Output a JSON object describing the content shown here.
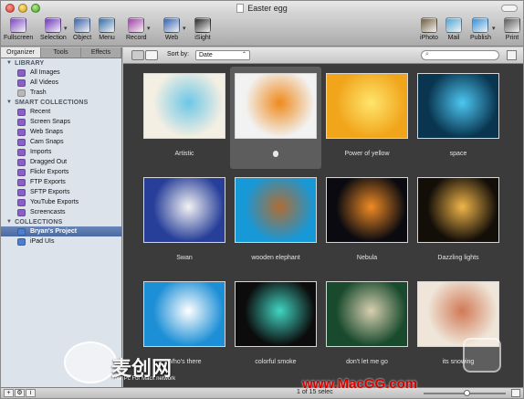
{
  "window": {
    "title": "Easter egg"
  },
  "toolbar": {
    "left": [
      {
        "label": "Fullscreen",
        "color": "#7a42c4"
      },
      {
        "label": "Selection",
        "color": "#6b2fbd"
      },
      {
        "label": "Object",
        "color": "#355ea8"
      },
      {
        "label": "Menu",
        "color": "#2c6aa8"
      },
      {
        "label": "Record",
        "color": "#a13aa7"
      },
      {
        "label": "Web",
        "color": "#2f5fb0"
      },
      {
        "label": "iSight",
        "color": "#222222"
      }
    ],
    "right": [
      {
        "label": "iPhoto",
        "color": "#6e5b3a"
      },
      {
        "label": "Mail",
        "color": "#4aa4d8"
      },
      {
        "label": "Publish",
        "color": "#2e8ed9"
      },
      {
        "label": "Print",
        "color": "#555555"
      }
    ]
  },
  "sidebar": {
    "tabs": [
      "Organizer",
      "Tools",
      "Effects"
    ],
    "sections": [
      {
        "title": "LIBRARY",
        "items": [
          {
            "label": "All Images",
            "color": "#8a60c8"
          },
          {
            "label": "All Videos",
            "color": "#8a60c8"
          },
          {
            "label": "Trash",
            "color": "#b8b8b8"
          }
        ]
      },
      {
        "title": "SMART COLLECTIONS",
        "items": [
          {
            "label": "Recent",
            "color": "#8a60c8"
          },
          {
            "label": "Screen Snaps",
            "color": "#8a60c8"
          },
          {
            "label": "Web Snaps",
            "color": "#8a60c8"
          },
          {
            "label": "Cam Snaps",
            "color": "#8a60c8"
          },
          {
            "label": "Imports",
            "color": "#8a60c8"
          },
          {
            "label": "Dragged Out",
            "color": "#8a60c8"
          },
          {
            "label": "Flickr Exports",
            "color": "#8a60c8"
          },
          {
            "label": "FTP Exports",
            "color": "#8a60c8"
          },
          {
            "label": "SFTP Exports",
            "color": "#8a60c8"
          },
          {
            "label": "YouTube Exports",
            "color": "#8a60c8"
          },
          {
            "label": "Screencasts",
            "color": "#8a60c8"
          }
        ]
      },
      {
        "title": "COLLECTIONS",
        "items": [
          {
            "label": "Bryan's Project",
            "color": "#4e7fcf",
            "selected": true
          },
          {
            "label": "iPad UIs",
            "color": "#4e7fcf"
          }
        ]
      }
    ]
  },
  "viewbar": {
    "sort_label": "Sort by:",
    "sort_value": "Date",
    "search_placeholder": ""
  },
  "images": [
    {
      "caption": "Artistic",
      "bg": "#f4efe3",
      "accent": "#6cc7e6"
    },
    {
      "caption": "",
      "bg": "#f2f2f2",
      "accent": "#ef8a1c",
      "selected": true
    },
    {
      "caption": "Power of yellow",
      "bg": "#f1a51b",
      "accent": "#ffe56d"
    },
    {
      "caption": "space",
      "bg": "#093550",
      "accent": "#4dc7f2"
    },
    {
      "caption": "Swan",
      "bg": "#283f9a",
      "accent": "#f3f3f3"
    },
    {
      "caption": "wooden elephant",
      "bg": "#1798d7",
      "accent": "#b06d34"
    },
    {
      "caption": "Nebula",
      "bg": "#0a0a10",
      "accent": "#f08b25"
    },
    {
      "caption": "Dazzling lights",
      "bg": "#130e08",
      "accent": "#f0b54a"
    },
    {
      "caption": "Who's there",
      "bg": "#1c8fd6",
      "accent": "#ffffff"
    },
    {
      "caption": "colorful smoke",
      "bg": "#0c0c0c",
      "accent": "#41d5c3"
    },
    {
      "caption": "don't let me go",
      "bg": "#194a2d",
      "accent": "#d7d0b0"
    },
    {
      "caption": "its snowing",
      "bg": "#efe6d9",
      "accent": "#d17955"
    }
  ],
  "statusbar": {
    "text": "1 of 15 selec"
  },
  "watermark": {
    "cn": "麦创网",
    "sub": "Your Pc For Macx network",
    "url": "www.MacGG.com"
  }
}
